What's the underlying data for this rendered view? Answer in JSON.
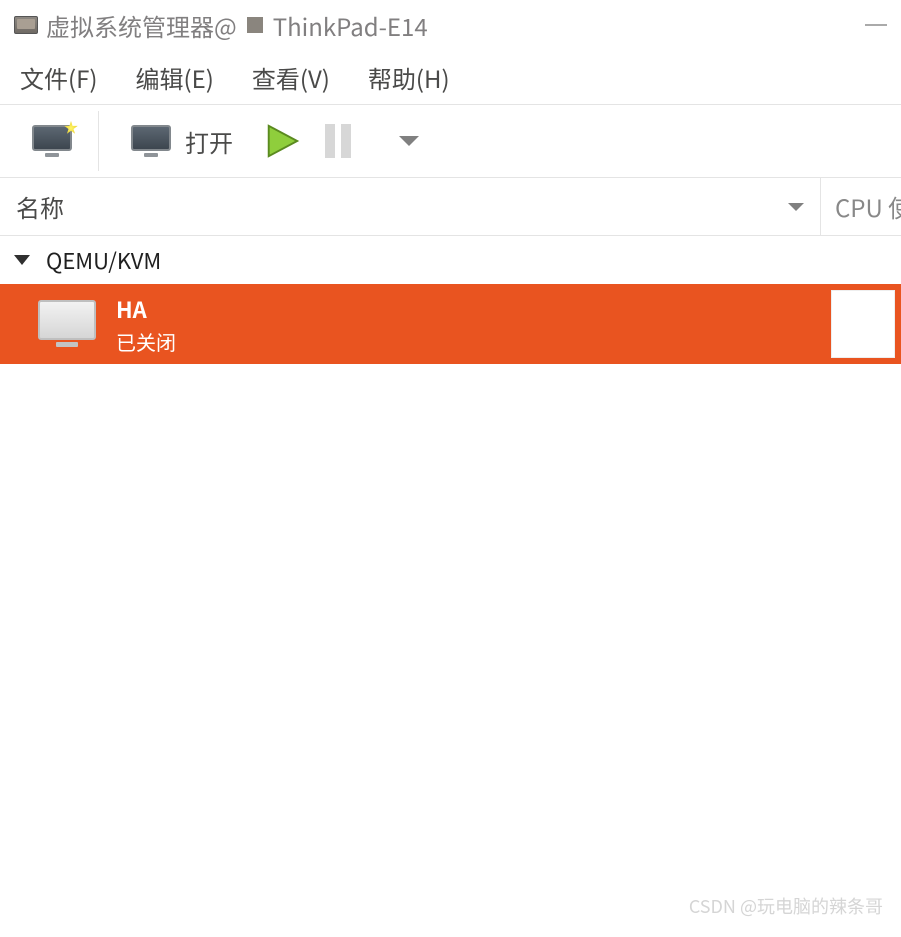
{
  "window": {
    "title_prefix": "虚拟系统管理器@",
    "host_label": "ThinkPad-E14"
  },
  "menubar": {
    "file": "文件(F)",
    "edit": "编辑(E)",
    "view": "查看(V)",
    "help": "帮助(H)"
  },
  "toolbar": {
    "open_label": "打开"
  },
  "columns": {
    "name": "名称",
    "cpu": "CPU 使"
  },
  "connection": {
    "label": "QEMU/KVM"
  },
  "vm": {
    "name": "HA",
    "status": "已关闭"
  },
  "watermark": "CSDN @玩电脑的辣条哥"
}
